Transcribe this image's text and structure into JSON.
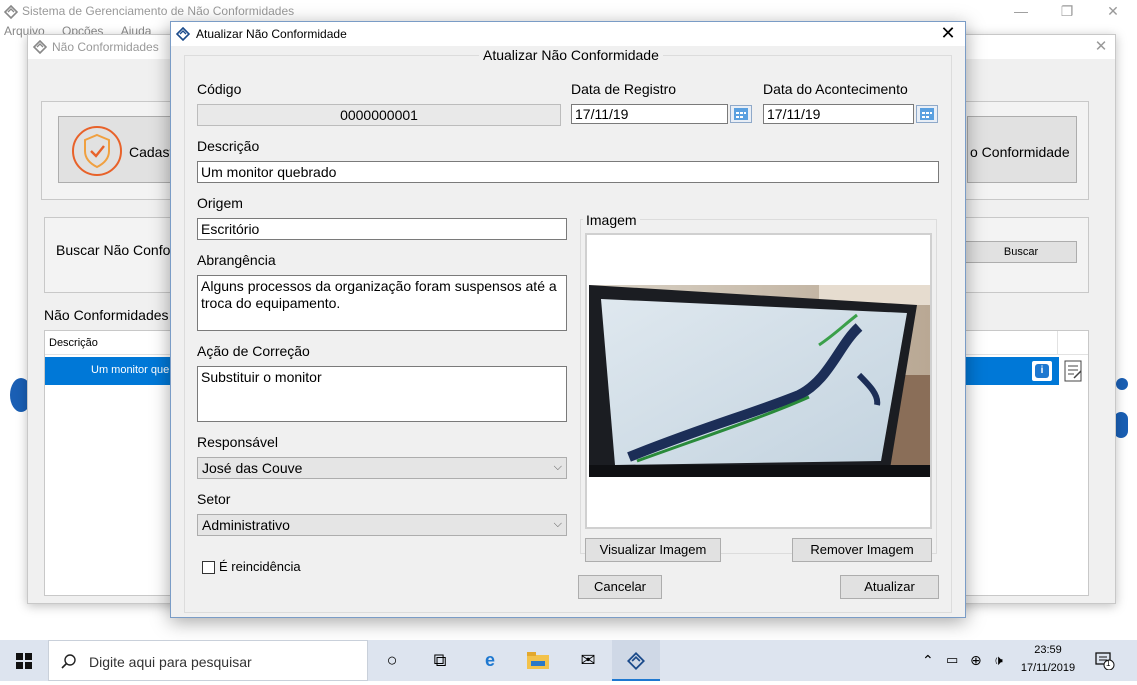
{
  "main_window": {
    "title": "Sistema de Gerenciamento de Não Conformidades",
    "menu": [
      "Arquivo",
      "Opções",
      "Ajuda"
    ]
  },
  "child_window": {
    "title": "Não Conformidades",
    "register_button_label": "Cadastr",
    "right_button_label": "o Conformidade",
    "search_label": "Buscar Não Confor",
    "search_button_label": "Buscar",
    "list_title": "Não Conformidades c",
    "table": {
      "header_description": "Descrição",
      "rows": [
        {
          "description": "Um monitor queb"
        }
      ]
    }
  },
  "dialog": {
    "title": "Atualizar Não Conformidade",
    "group_title": "Atualizar Não Conformidade",
    "codigo": {
      "label": "Código",
      "value": "0000000001"
    },
    "data_registro": {
      "label": "Data de Registro",
      "value": "17/11/19"
    },
    "data_acontecimento": {
      "label": "Data do Acontecimento",
      "value": "17/11/19"
    },
    "descricao": {
      "label": "Descrição",
      "value": "Um monitor quebrado"
    },
    "origem": {
      "label": "Origem",
      "value": "Escritório"
    },
    "abrangencia": {
      "label": "Abrangência",
      "value": "Alguns processos da organização foram suspensos até a troca do equipamento."
    },
    "acao_correcao": {
      "label": "Ação de Correção",
      "value": "Substituir o monitor"
    },
    "responsavel": {
      "label": "Responsável",
      "value": "José das Couve"
    },
    "setor": {
      "label": "Setor",
      "value": "Administrativo"
    },
    "reincidencia": {
      "label": "É reincidência",
      "checked": false
    },
    "imagem": {
      "label": "Imagem"
    },
    "buttons": {
      "view_image": "Visualizar Imagem",
      "remove_image": "Remover Imagem",
      "cancel": "Cancelar",
      "update": "Atualizar"
    }
  },
  "taskbar": {
    "search_placeholder": "Digite aqui para pesquisar",
    "clock_time": "23:59",
    "clock_date": "17/11/2019",
    "notification_count": "1"
  }
}
